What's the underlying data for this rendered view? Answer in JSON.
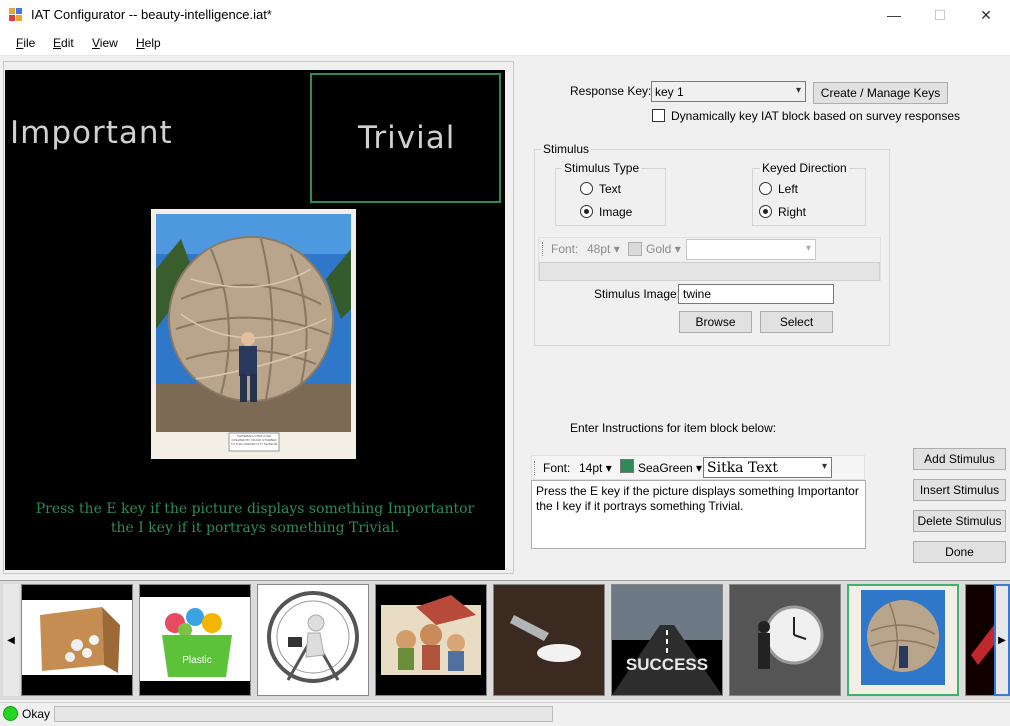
{
  "window": {
    "title": "IAT Configurator -- beauty-intelligence.iat*",
    "minimize_glyph": "—",
    "maximize_glyph": "☐",
    "close_glyph": "✕"
  },
  "menu": {
    "file": {
      "accel": "F",
      "rest": "ile"
    },
    "edit": {
      "accel": "E",
      "rest": "dit"
    },
    "view": {
      "accel": "V",
      "rest": "iew"
    },
    "help": {
      "accel": "H",
      "rest": "elp"
    }
  },
  "preview": {
    "left_category": "Important",
    "right_category": "Trivial",
    "instructions_line1": "Press the E key if the picture displays something Importantor",
    "instructions_line2": "the I key if it portrays something Trivial.",
    "instructions_color": "#2e8b57",
    "category_color": "#d0d0d0",
    "photo_caption_1": "TWINEBALL DISPLAYED",
    "photo_caption_2": "CREATED BY FRANK STOEBER",
    "photo_caption_3": "TO THE CAWKER CITY MUSEUM"
  },
  "response_key": {
    "label": "Response Key:",
    "selected": "key 1",
    "manage_button": "Create / Manage Keys",
    "dynamic_checkbox_label": "Dynamically key IAT block based on survey responses",
    "dynamic_checked": false
  },
  "stimulus": {
    "group_title": "Stimulus",
    "type_group_title": "Stimulus Type",
    "type_text": "Text",
    "type_image": "Image",
    "selected_type": "Image",
    "direction_group_title": "Keyed Direction",
    "direction_left": "Left",
    "direction_right": "Right",
    "selected_direction": "Right",
    "font_label": "Font:",
    "font_size": "48pt",
    "color_name": "Gold",
    "color_swatch": "#d9d9d9",
    "font_family": "",
    "image_label": "Stimulus Image:",
    "image_value": "twine",
    "browse_button": "Browse",
    "select_button": "Select"
  },
  "instructions": {
    "heading": "Enter Instructions for item block below:",
    "font_label": "Font:",
    "font_size": "14pt",
    "color_name": "SeaGreen",
    "color_swatch": "#2e8b57",
    "font_family": "Sitka Text",
    "text": "Press the E key if the picture displays something Importantor the I key if it portrays something Trivial."
  },
  "actions": {
    "add": "Add Stimulus",
    "insert": "Insert Stimulus",
    "delete": "Delete Stimulus",
    "done": "Done"
  },
  "thumbnails": [
    {
      "name": "packing-peanuts-box"
    },
    {
      "name": "plastic-recycling-bin"
    },
    {
      "name": "hamster-wheel-figure"
    },
    {
      "name": "cartoon-family-house"
    },
    {
      "name": "spilled-milk-glass"
    },
    {
      "name": "success-road"
    },
    {
      "name": "clock-man"
    },
    {
      "name": "twine-ball",
      "selected": true
    },
    {
      "name": "red-abstract"
    }
  ],
  "status": {
    "text": "Okay",
    "indicator_color": "#22d622"
  }
}
